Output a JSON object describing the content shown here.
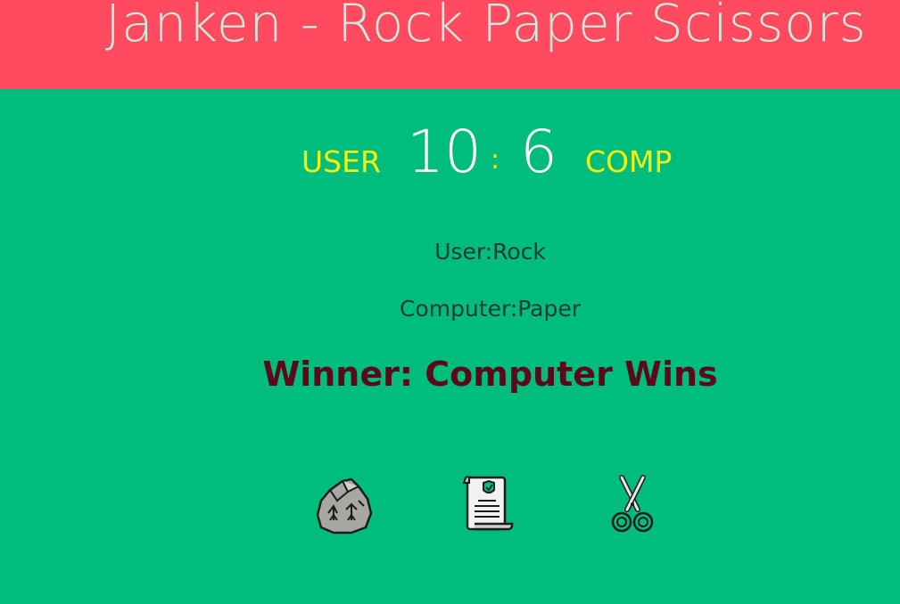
{
  "header": {
    "title": "Janken - Rock Paper Scissors",
    "background_color": "#ff4a5f"
  },
  "scoreboard": {
    "user_label": "USER",
    "user_score": "10",
    "separator": ":",
    "comp_score": "6",
    "comp_label": "COMP"
  },
  "result": {
    "user_choice": "User:Rock",
    "computer_choice": "Computer:Paper",
    "winner": "Winner: Computer Wins"
  },
  "choices": [
    {
      "name": "rock",
      "icon": "rock-icon"
    },
    {
      "name": "paper",
      "icon": "scroll-icon"
    },
    {
      "name": "scissors",
      "icon": "scissors-icon"
    }
  ],
  "colors": {
    "background": "#00bd7e",
    "accent_yellow": "#f4f20a",
    "winner_text": "#5a0a18"
  }
}
